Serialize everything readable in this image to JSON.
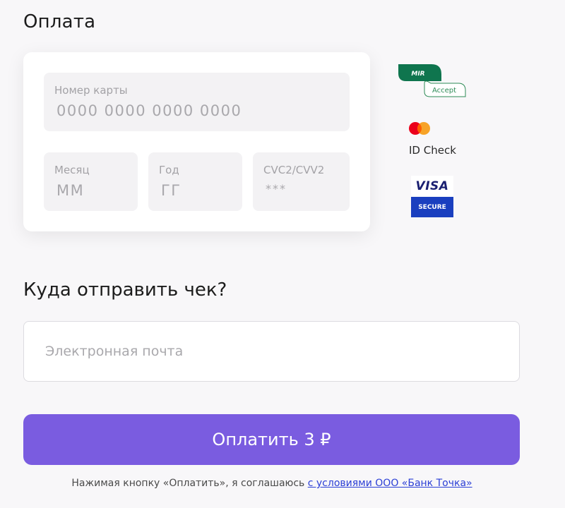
{
  "page": {
    "title": "Оплата"
  },
  "card_form": {
    "number": {
      "label": "Номер карты",
      "placeholder": "0000 0000 0000 0000"
    },
    "month": {
      "label": "Месяц",
      "placeholder": "ММ"
    },
    "year": {
      "label": "Год",
      "placeholder": "ГГ"
    },
    "cvc": {
      "label": "CVC2/CVV2",
      "placeholder": "***"
    }
  },
  "badges": {
    "mir": {
      "logo": "MIR",
      "text": "Accept"
    },
    "mastercard": {
      "text": "ID Check"
    },
    "visa": {
      "logo": "VISA",
      "text": "SECURE"
    }
  },
  "receipt": {
    "title": "Куда отправить чек?",
    "email_placeholder": "Электронная почта"
  },
  "pay_button": {
    "label": "Оплатить 3 ₽"
  },
  "terms": {
    "text": "Нажимая кнопку «Оплатить», я соглашаюсь",
    "link": "с условиями ООО «Банк Точка»"
  },
  "colors": {
    "accent": "#7a5ce0",
    "link": "#2b3fd6",
    "mir_green": "#0f754e",
    "visa_blue": "#1a1f71",
    "mastercard_red": "#eb001b",
    "mastercard_orange": "#f79e1b"
  },
  "icons": [
    "mir-accept-logo-icon",
    "mastercard-logo-icon",
    "visa-secure-logo-icon"
  ]
}
